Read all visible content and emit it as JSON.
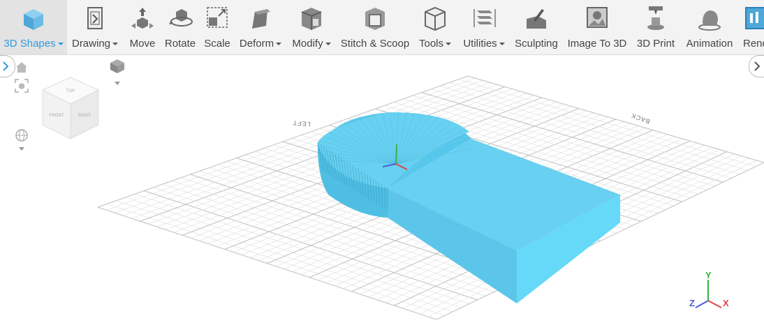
{
  "toolbar": {
    "items": [
      {
        "label": "3D Shapes",
        "dropdown": true,
        "active": true,
        "icon": "cube-icon"
      },
      {
        "label": "Drawing",
        "dropdown": true,
        "icon": "drawing-icon"
      },
      {
        "label": "Move",
        "icon": "move-icon"
      },
      {
        "label": "Rotate",
        "icon": "rotate-icon"
      },
      {
        "label": "Scale",
        "icon": "scale-icon"
      },
      {
        "label": "Deform",
        "dropdown": true,
        "icon": "deform-icon"
      },
      {
        "label": "Modify",
        "dropdown": true,
        "icon": "modify-icon"
      },
      {
        "label": "Stitch & Scoop",
        "icon": "stitch-scoop-icon"
      },
      {
        "label": "Tools",
        "dropdown": true,
        "icon": "tools-icon"
      },
      {
        "label": "Utilities",
        "dropdown": true,
        "icon": "utilities-icon"
      },
      {
        "label": "Sculpting",
        "icon": "sculpting-icon"
      },
      {
        "label": "Image To 3D",
        "icon": "image-to-3d-icon"
      },
      {
        "label": "3D Print",
        "icon": "3d-print-icon"
      },
      {
        "label": "Animation",
        "icon": "animation-icon"
      },
      {
        "label": "Rend",
        "icon": "render-icon"
      }
    ]
  },
  "view_cube": {
    "top": "TOP",
    "front": "FRONT",
    "right": "RIGHT"
  },
  "ground_labels": {
    "left": "LEFT",
    "back": "BACK"
  },
  "axis_gizmo": {
    "x": "X",
    "y": "Y",
    "z": "Z"
  },
  "colors": {
    "accent": "#2d9be0",
    "model_top": "#68d0f0",
    "model_side": "#5cc6ea",
    "model_front": "#66d8f8",
    "axis_x": "#e24444",
    "axis_y": "#3cb043",
    "axis_z": "#4a5ed8"
  }
}
